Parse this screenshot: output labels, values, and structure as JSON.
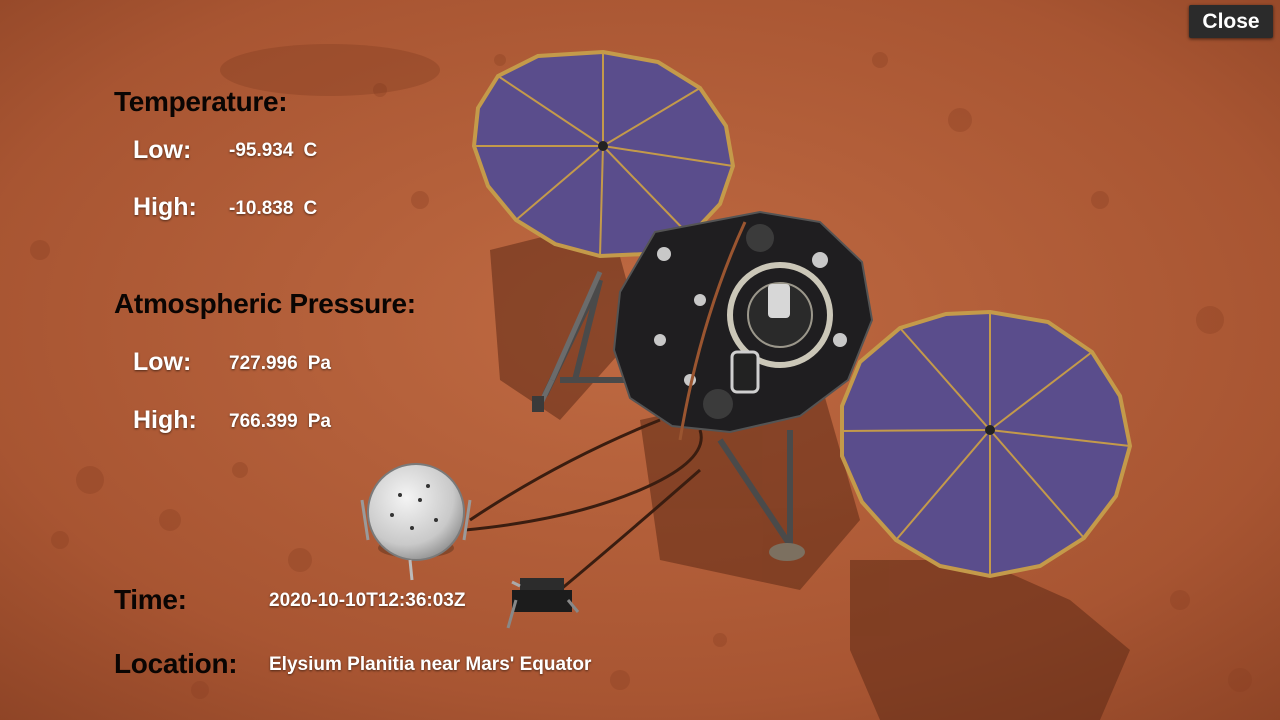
{
  "close_label": "Close",
  "temperature": {
    "heading": "Temperature:",
    "low": {
      "label": "Low:",
      "value": "-95.934",
      "unit": "C"
    },
    "high": {
      "label": "High:",
      "value": "-10.838",
      "unit": "C"
    }
  },
  "pressure": {
    "heading": "Atmospheric Pressure:",
    "low": {
      "label": "Low:",
      "value": "727.996",
      "unit": "Pa"
    },
    "high": {
      "label": "High:",
      "value": "766.399",
      "unit": "Pa"
    }
  },
  "time": {
    "label": "Time:",
    "value": "2020-10-10T12:36:03Z"
  },
  "location": {
    "label": "Location:",
    "value": "Elysium Planitia near Mars' Equator"
  },
  "colors": {
    "ground": "#b5603a",
    "panel": "#5a4d8c",
    "deck": "#1f1e20",
    "close_bg": "#2b2b2b"
  }
}
